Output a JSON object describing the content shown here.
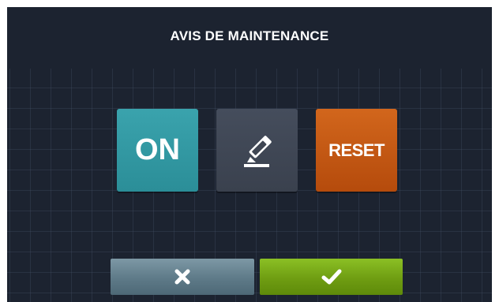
{
  "header": {
    "title": "AVIS DE MAINTENANCE"
  },
  "tiles": {
    "on_label": "ON",
    "edit_icon": "pencil-eraser-icon",
    "reset_label": "RESET"
  },
  "footer": {
    "cancel_icon": "close-icon",
    "confirm_icon": "check-icon"
  },
  "colors": {
    "background": "#1c2330",
    "on_tile": "#2f96a0",
    "edit_tile": "#3f4653",
    "reset_tile": "#c2560f",
    "cancel_bar": "#6a8694",
    "confirm_bar": "#76a716"
  }
}
